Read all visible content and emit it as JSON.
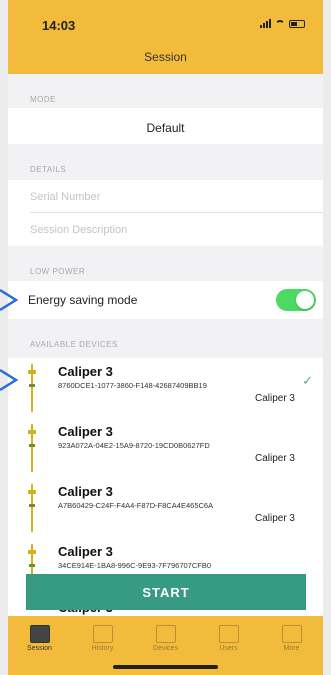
{
  "status_bar": {
    "time": "14:03"
  },
  "header": {
    "title": "Session"
  },
  "mode": {
    "section_label": "MODE",
    "value": "Default"
  },
  "details": {
    "section_label": "DETAILS",
    "serial_placeholder": "Serial Number",
    "description_placeholder": "Session Description"
  },
  "low_power": {
    "section_label": "LOW POWER",
    "energy_label": "Energy saving mode",
    "energy_on": true
  },
  "devices": {
    "section_label": "AVAILABLE DEVICES",
    "items": [
      {
        "name": "Caliper 3",
        "id": "8760DCE1-1077-3860-F148-42687409BB19",
        "type": "Caliper 3",
        "selected": true
      },
      {
        "name": "Caliper 3",
        "id": "923A072A-04E2-15A9-8720-19CD0B0627FD",
        "type": "Caliper 3",
        "selected": false
      },
      {
        "name": "Caliper 3",
        "id": "A7B60429-C24F-F4A4-F87D-F8CA4E465C6A",
        "type": "Caliper 3",
        "selected": false
      },
      {
        "name": "Caliper 3",
        "id": "34CE914E-1BA8-996C-9E93-7F796707CFB0",
        "type": "",
        "selected": false
      },
      {
        "name": "Caliper 3",
        "id": "",
        "type": "",
        "selected": false
      }
    ]
  },
  "start_button": "START",
  "tabs": [
    {
      "label": "Session",
      "icon": "session-icon",
      "active": true
    },
    {
      "label": "History",
      "icon": "history-icon",
      "active": false
    },
    {
      "label": "Devices",
      "icon": "devices-icon",
      "active": false
    },
    {
      "label": "Users",
      "icon": "users-icon",
      "active": false
    },
    {
      "label": "More",
      "icon": "more-icon",
      "active": false
    }
  ],
  "colors": {
    "header": "#f3bb3c",
    "accent": "#379a82",
    "toggle": "#4cd964",
    "check": "#4fae8f"
  }
}
